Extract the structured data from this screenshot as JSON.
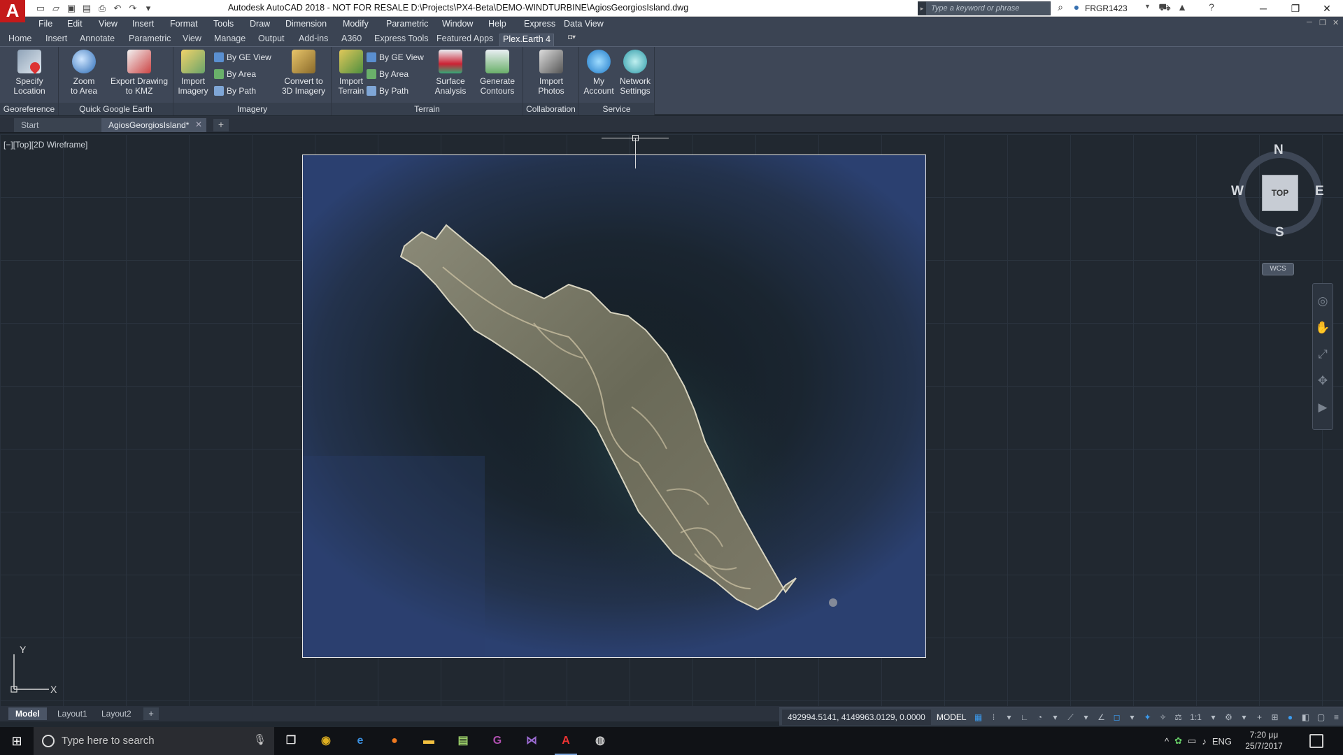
{
  "window": {
    "title": "Autodesk AutoCAD 2018 - NOT FOR RESALE   D:\\Projects\\PX4-Beta\\DEMO-WINDTURBINE\\AgiosGeorgiosIsland.dwg",
    "logo": "A",
    "search_placeholder": "Type a keyword or phrase",
    "username": "FRGR1423"
  },
  "menu": [
    "File",
    "Edit",
    "View",
    "Insert",
    "Format",
    "Tools",
    "Draw",
    "Dimension",
    "Modify",
    "Parametric",
    "Window",
    "Help",
    "Express",
    "Data View"
  ],
  "ribbon_tabs": [
    "Home",
    "Insert",
    "Annotate",
    "Parametric",
    "View",
    "Manage",
    "Output",
    "Add-ins",
    "A360",
    "Express Tools",
    "Featured Apps",
    "Plex.Earth 4"
  ],
  "ribbon": {
    "georeference": {
      "label": "Georeference",
      "specify": "Specify\nLocation"
    },
    "quick_ge": {
      "label": "Quick Google Earth",
      "zoom": "Zoom\nto Area",
      "export": "Export Drawing\nto KMZ"
    },
    "imagery": {
      "label": "Imagery",
      "import": "Import\nImagery",
      "by_ge_view": "By GE View",
      "by_area": "By Area",
      "by_path": "By Path",
      "convert": "Convert to\n3D Imagery"
    },
    "terrain": {
      "label": "Terrain",
      "import": "Import\nTerrain",
      "by_ge_view": "By GE View",
      "by_area": "By Area",
      "by_path": "By Path",
      "surface": "Surface\nAnalysis",
      "contours": "Generate\nContours"
    },
    "collaboration": {
      "label": "Collaboration",
      "import_photos": "Import\nPhotos"
    },
    "service": {
      "label": "Service",
      "account": "My\nAccount",
      "network": "Network\nSettings"
    }
  },
  "doc_tabs": {
    "start": "Start",
    "drawing": "AgiosGeorgiosIsland*"
  },
  "viewport": {
    "label": "[−][Top][2D Wireframe]"
  },
  "viewcube": {
    "n": "N",
    "s": "S",
    "e": "E",
    "w": "W",
    "face": "TOP",
    "wcs": "WCS"
  },
  "ucs": {
    "x": "X",
    "y": "Y"
  },
  "layout_tabs": [
    "Model",
    "Layout1",
    "Layout2"
  ],
  "status": {
    "coords": "492994.5141, 4149963.0129, 0.0000",
    "space": "MODEL",
    "scale": "1:1"
  },
  "taskbar": {
    "search_placeholder": "Type here to search",
    "lang": "ENG",
    "time": "7:20 μμ",
    "date": "25/7/2017"
  }
}
